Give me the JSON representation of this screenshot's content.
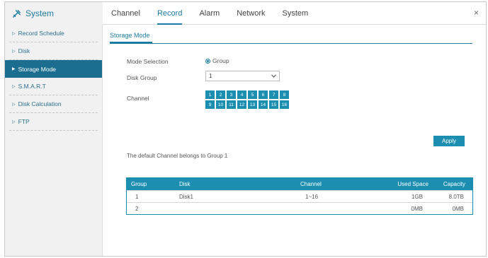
{
  "header": {
    "title": "System",
    "tabs": [
      "Channel",
      "Record",
      "Alarm",
      "Network",
      "System"
    ],
    "active_tab": "Record",
    "close_label": "×"
  },
  "sidebar": {
    "items": [
      {
        "label": "Record Schedule",
        "active": false
      },
      {
        "label": "Disk",
        "active": false
      },
      {
        "label": "Storage Mode",
        "active": true
      },
      {
        "label": "S.M.A.R.T",
        "active": false
      },
      {
        "label": "Disk Calculation",
        "active": false
      },
      {
        "label": "FTP",
        "active": false
      }
    ]
  },
  "main": {
    "subtab": "Storage Mode",
    "mode_selection_label": "Mode Selection",
    "mode_value": "Group",
    "disk_group_label": "Disk Group",
    "disk_group_value": "1",
    "channel_label": "Channel",
    "channels": [
      "1",
      "2",
      "3",
      "4",
      "5",
      "6",
      "7",
      "8",
      "9",
      "10",
      "11",
      "12",
      "13",
      "14",
      "15",
      "16"
    ],
    "apply_label": "Apply",
    "note": "The default Channel belongs to Group 1",
    "table": {
      "headers": {
        "group": "Group",
        "disk": "Disk",
        "channel": "Channel",
        "used": "Used Space",
        "capacity": "Capacity"
      },
      "rows": [
        {
          "group": "1",
          "disk": "Disk1",
          "channel": "1~16",
          "used": "1GB",
          "capacity": "8.0TB"
        },
        {
          "group": "2",
          "disk": "",
          "channel": "",
          "used": "0MB",
          "capacity": "0MB"
        }
      ]
    }
  },
  "colors": {
    "accent": "#1c8fb0",
    "sidebar_active": "#1c6e91",
    "link": "#1c7ca3"
  }
}
